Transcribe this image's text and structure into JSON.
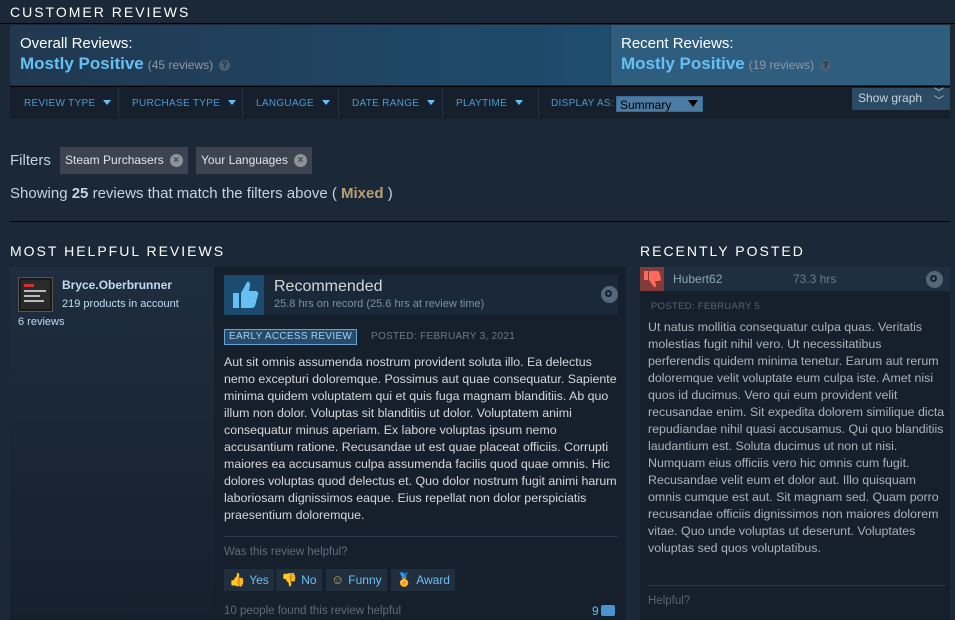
{
  "customer_reviews": {
    "title": "CUSTOMER REVIEWS",
    "overall": {
      "label": "Overall Reviews:",
      "rating": "Mostly Positive",
      "count": "(45 reviews)"
    },
    "recent": {
      "label": "Recent Reviews:",
      "rating": "Mostly Positive",
      "count": "(19 reviews)"
    }
  },
  "filter_bar": {
    "review_type": "REVIEW TYPE",
    "purchase_type": "PURCHASE TYPE",
    "language": "LANGUAGE",
    "date_range": "DATE RANGE",
    "playtime": "PLAYTIME",
    "display_as_label": "DISPLAY AS:",
    "display_as_value": "Summary",
    "show_graph": "Show graph"
  },
  "filters": {
    "label": "Filters",
    "chips": [
      "Steam Purchasers",
      "Your Languages"
    ],
    "showing_prefix": "Showing ",
    "showing_count": "25",
    "showing_suffix": " reviews that match the filters above ( ",
    "showing_mixed": "Mixed",
    "showing_end": " )"
  },
  "most_helpful": {
    "title": "MOST HELPFUL REVIEWS",
    "review": {
      "author": "Bryce.Oberbrunner",
      "products": "219 products in account",
      "reviews": "6 reviews",
      "verdict": "Recommended",
      "hours": "25.8 hrs on record (25.6 hrs at review time)",
      "badge": "EARLY ACCESS REVIEW",
      "posted": "POSTED: FEBRUARY 3, 2021",
      "body": "Aut sit omnis assumenda nostrum provident soluta illo. Ea delectus nemo excepturi doloremque. Possimus aut quae consequatur. Sapiente minima quidem voluptatem qui et quis fuga magnam blanditiis. Ab quo illum non dolor. Voluptas sit blanditiis ut dolor. Voluptatem animi consequatur minus aperiam. Ex labore voluptas ipsum nemo accusantium ratione. Recusandae ut est quae placeat officiis. Corrupti maiores ea accusamus culpa assumenda facilis quod quae omnis. Hic dolores voluptas quod delectus et. Quo dolor nostrum fugit animi harum laboriosam dignissimos eaque. Eius repellat non dolor perspiciatis praesentium doloremque.",
      "helpful_question": "Was this review helpful?",
      "buttons": {
        "yes": "Yes",
        "no": "No",
        "funny": "Funny",
        "award": "Award"
      },
      "found_helpful": "10 people found this review helpful",
      "comments": "9"
    }
  },
  "recently_posted": {
    "title": "RECENTLY POSTED",
    "review": {
      "author": "Hubert62",
      "hours": "73.3 hrs",
      "posted": "POSTED: FEBRUARY 5",
      "body": "Ut natus mollitia consequatur culpa quas. Veritatis molestias fugit nihil vero. Ut necessitatibus perferendis quidem minima tenetur. Earum aut rerum doloremque velit voluptate eum culpa iste. Amet nisi quos id ducimus. Vero qui eum provident velit recusandae enim. Sit expedita dolorem similique dicta repudiandae nihil quasi accusamus. Qui quo blanditiis laudantium est. Soluta ducimus ut non ut nisi. Numquam eius officiis vero hic omnis cum fugit. Recusandae velit eum et dolor aut. Illo quisquam omnis cumque est aut. Sit magnam sed. Quam porro recusandae officiis dignissimos non maiores dolorem vitae. Quo unde voluptas ut deserunt. Voluptates voluptas sed quos voluptatibus.",
      "helpful": "Helpful?"
    }
  },
  "colors": {
    "accent": "#66c0f4",
    "mixed": "#b9a074",
    "background": "#1b2838"
  }
}
